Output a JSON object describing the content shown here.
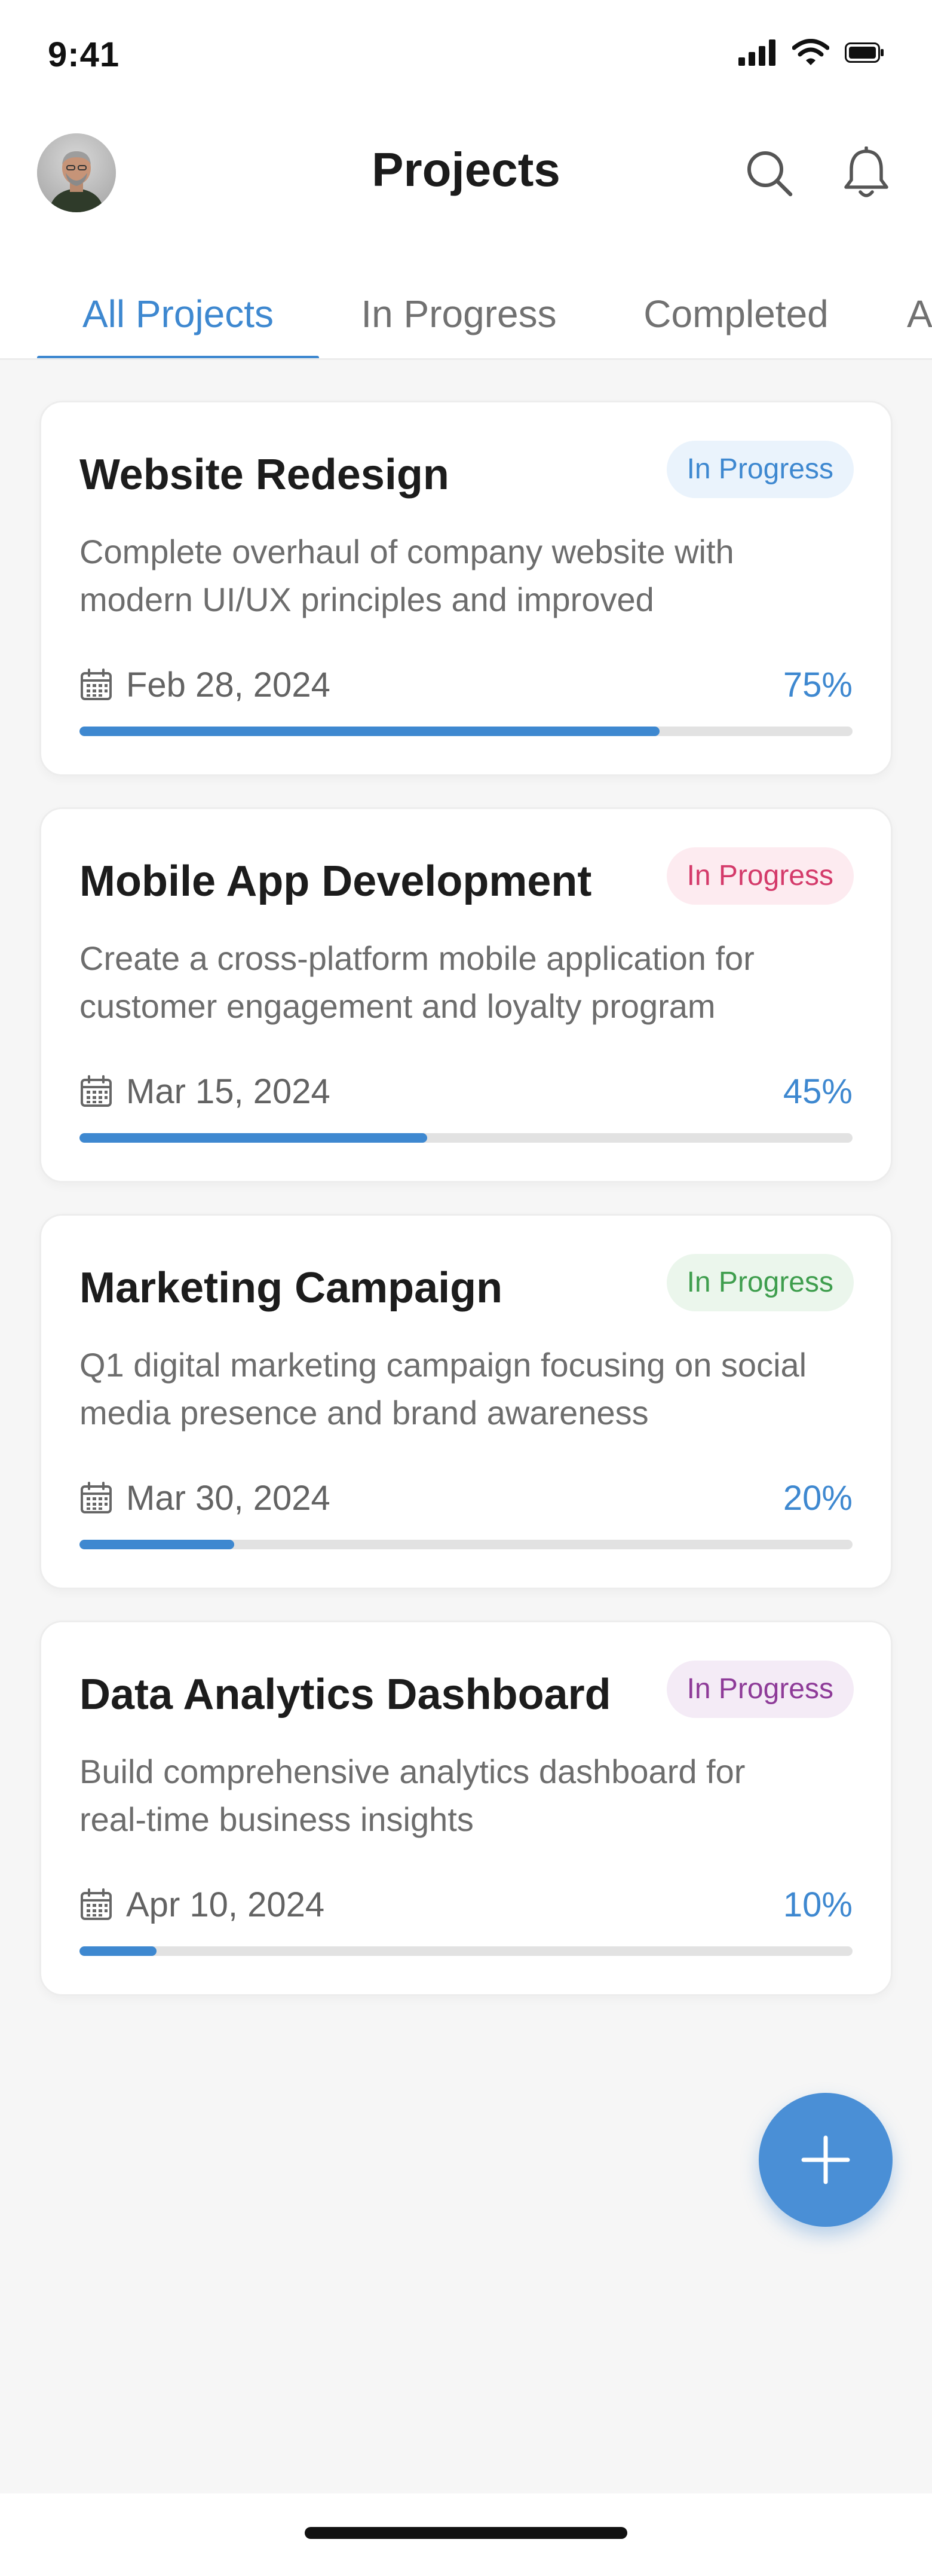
{
  "status_bar": {
    "time": "9:41"
  },
  "header": {
    "title": "Projects"
  },
  "tabs": [
    {
      "label": "All Projects",
      "active": true
    },
    {
      "label": "In Progress",
      "active": false
    },
    {
      "label": "Completed",
      "active": false
    },
    {
      "label": "Archived",
      "active": false
    }
  ],
  "projects": [
    {
      "title": "Website Redesign",
      "status": "In Progress",
      "status_color": "#3e88d0",
      "status_bg": "#eaf3fc",
      "description_line1": "Complete overhaul of company website with",
      "description_line2": "modern UI/UX principles and improved",
      "due_date": "Feb 28, 2024",
      "progress_label": "75%",
      "progress": 0.75
    },
    {
      "title": "Mobile App Development",
      "status": "In Progress",
      "status_color": "#d43a6a",
      "status_bg": "#fdebf0",
      "description_line1": "Create a cross-platform mobile application for",
      "description_line2": "customer engagement and loyalty program",
      "due_date": "Mar 15, 2024",
      "progress_label": "45%",
      "progress": 0.45
    },
    {
      "title": "Marketing Campaign",
      "status": "In Progress",
      "status_color": "#3f9e4e",
      "status_bg": "#ebf6ec",
      "description_line1": "Q1 digital marketing campaign focusing on social",
      "description_line2": "media presence and brand awareness",
      "due_date": "Mar 30, 2024",
      "progress_label": "20%",
      "progress": 0.2
    },
    {
      "title": "Data Analytics Dashboard",
      "status": "In Progress",
      "status_color": "#8e3b98",
      "status_bg": "#f4ebf6",
      "description_line1": "Build comprehensive analytics dashboard for",
      "description_line2": "real-time business insights",
      "due_date": "Apr 10, 2024",
      "progress_label": "10%",
      "progress": 0.1
    }
  ],
  "icons": {
    "search": "search-icon",
    "notifications": "bell-icon",
    "calendar": "calendar-icon",
    "add": "plus-icon"
  },
  "colors": {
    "accent": "#3e88d0",
    "background": "#f6f6f6",
    "card": "#ffffff"
  }
}
